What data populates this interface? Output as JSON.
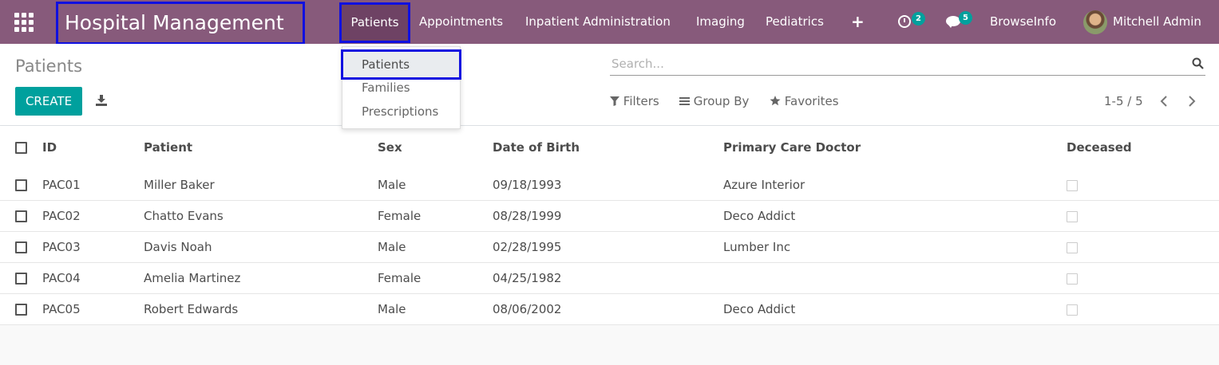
{
  "navbar": {
    "brand": "Hospital Management",
    "menus": [
      {
        "label": "Patients"
      },
      {
        "label": "Appointments"
      },
      {
        "label": "Inpatient Administration"
      },
      {
        "label": "Imaging"
      },
      {
        "label": "Pediatrics"
      }
    ],
    "activities_count": "2",
    "messages_count": "5",
    "company": "BrowseInfo",
    "user": "Mitchell Admin"
  },
  "dropdown": {
    "items": [
      "Patients",
      "Families",
      "Prescriptions"
    ]
  },
  "control": {
    "title": "Patients",
    "create_label": "CREATE",
    "search_placeholder": "Search...",
    "filters_label": "Filters",
    "groupby_label": "Group By",
    "favorites_label": "Favorites",
    "pager": "1-5 / 5"
  },
  "table": {
    "columns": [
      "ID",
      "Patient",
      "Sex",
      "Date of Birth",
      "Primary Care Doctor",
      "Deceased"
    ],
    "rows": [
      {
        "id": "PAC01",
        "patient": "Miller Baker",
        "sex": "Male",
        "dob": "09/18/1993",
        "doctor": "Azure Interior"
      },
      {
        "id": "PAC02",
        "patient": "Chatto Evans",
        "sex": "Female",
        "dob": "08/28/1999",
        "doctor": "Deco Addict"
      },
      {
        "id": "PAC03",
        "patient": "Davis Noah",
        "sex": "Male",
        "dob": "02/28/1995",
        "doctor": "Lumber Inc"
      },
      {
        "id": "PAC04",
        "patient": "Amelia Martinez",
        "sex": "Female",
        "dob": "04/25/1982",
        "doctor": ""
      },
      {
        "id": "PAC05",
        "patient": "Robert Edwards",
        "sex": "Male",
        "dob": "08/06/2002",
        "doctor": "Deco Addict"
      }
    ]
  },
  "colors": {
    "navbar": "#875a7b",
    "accent": "#00a09d",
    "highlight_border": "#1010e0"
  }
}
